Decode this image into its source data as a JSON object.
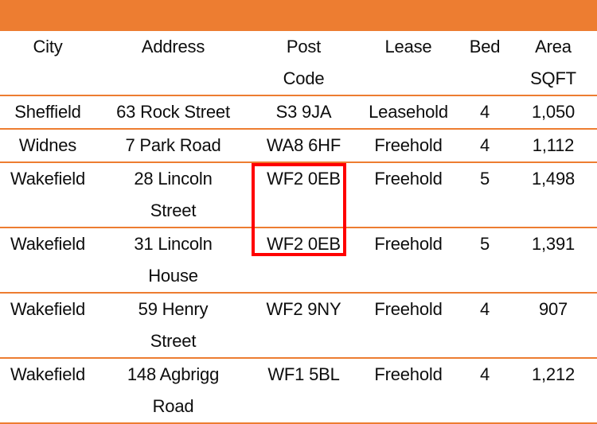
{
  "banner": {
    "color": "#ED7D31",
    "label": ""
  },
  "table": {
    "rule_color": "#ED7D31",
    "text_color": "#0D0D0D",
    "headers": [
      {
        "line1": "City",
        "line2": ""
      },
      {
        "line1": "Address",
        "line2": ""
      },
      {
        "line1": "Post",
        "line2": "Code"
      },
      {
        "line1": "Lease",
        "line2": ""
      },
      {
        "line1": "Bed",
        "line2": ""
      },
      {
        "line1": "Area",
        "line2": "SQFT"
      }
    ],
    "rows": [
      {
        "city": "Sheffield",
        "address_line1": "63 Rock Street",
        "address_line2": "",
        "post_code": "S3 9JA",
        "lease": "Leasehold",
        "bed": "4",
        "area_sqft": "1,050"
      },
      {
        "city": "Widnes",
        "address_line1": "7 Park Road",
        "address_line2": "",
        "post_code": "WA8 6HF",
        "lease": "Freehold",
        "bed": "4",
        "area_sqft": "1,112"
      },
      {
        "city": "Wakefield",
        "address_line1": "28 Lincoln",
        "address_line2": "Street",
        "post_code": "WF2 0EB",
        "lease": "Freehold",
        "bed": "5",
        "area_sqft": "1,498"
      },
      {
        "city": "Wakefield",
        "address_line1": "31 Lincoln",
        "address_line2": "House",
        "post_code": "WF2 0EB",
        "lease": "Freehold",
        "bed": "5",
        "area_sqft": "1,391"
      },
      {
        "city": "Wakefield",
        "address_line1": "59 Henry",
        "address_line2": "Street",
        "post_code": "WF2 9NY",
        "lease": "Freehold",
        "bed": "4",
        "area_sqft": "907"
      },
      {
        "city": "Wakefield",
        "address_line1": "148 Agbrigg",
        "address_line2": "Road",
        "post_code": "WF1 5BL",
        "lease": "Freehold",
        "bed": "4",
        "area_sqft": "1,212"
      }
    ]
  },
  "annotation": {
    "highlight_color": "#FF0000",
    "target": "duplicate-post-code",
    "value": "WF2 0EB"
  }
}
